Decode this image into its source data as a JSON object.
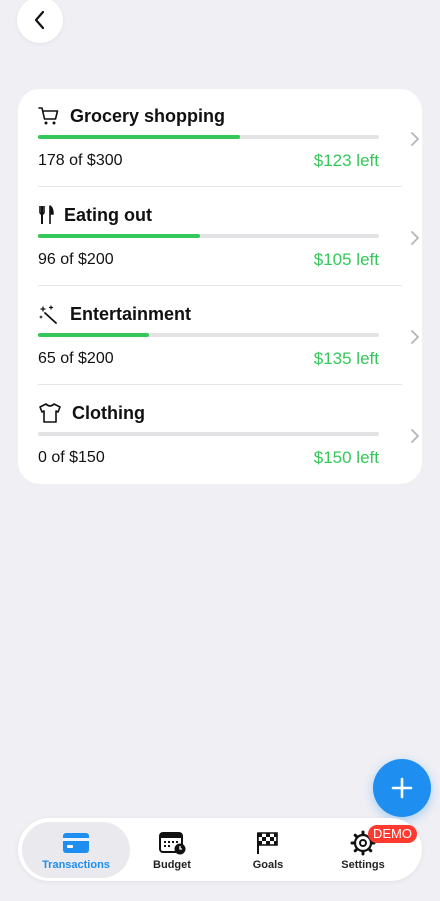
{
  "header": {
    "back_icon": "chevron-left-icon"
  },
  "categories": [
    {
      "name": "Grocery shopping",
      "icon": "cart-icon",
      "spent_text": "178 of $300",
      "left_text": "$123 left",
      "progress": 0.593
    },
    {
      "name": "Eating out",
      "icon": "fork-knife-icon",
      "spent_text": "96 of $200",
      "left_text": "$105 left",
      "progress": 0.475
    },
    {
      "name": "Entertainment",
      "icon": "magic-wand-icon",
      "spent_text": "65 of $200",
      "left_text": "$135 left",
      "progress": 0.325
    },
    {
      "name": "Clothing",
      "icon": "shirt-icon",
      "spent_text": "0 of $150",
      "left_text": "$150 left",
      "progress": 0.0
    }
  ],
  "fab": {
    "icon": "plus-icon"
  },
  "tabbar": {
    "tabs": [
      {
        "label": "Transactions",
        "icon": "credit-card-icon",
        "active": true
      },
      {
        "label": "Budget",
        "icon": "calendar-clock-icon",
        "active": false
      },
      {
        "label": "Goals",
        "icon": "checkered-flag-icon",
        "active": false
      },
      {
        "label": "Settings",
        "icon": "gear-icon",
        "active": false
      }
    ],
    "badge": "DEMO"
  },
  "colors": {
    "accent": "#1e8ff0",
    "progress": "#34c759",
    "badge": "#ff3b30",
    "background": "#efeff4"
  }
}
